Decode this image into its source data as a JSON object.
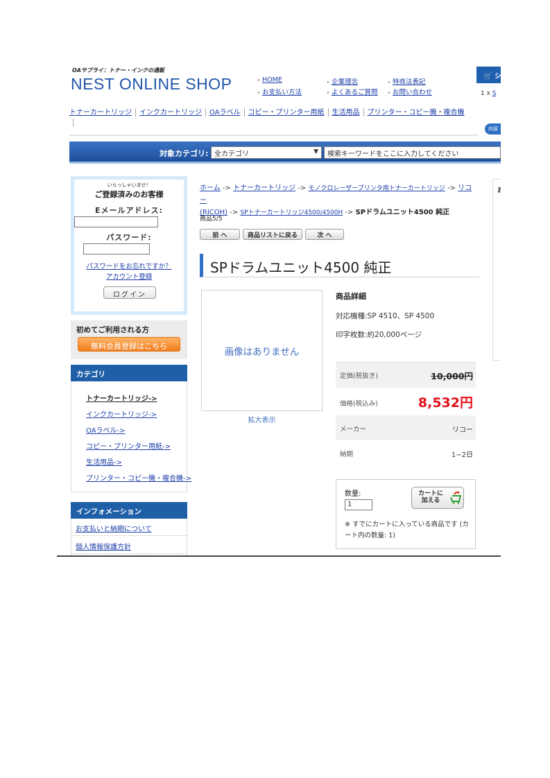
{
  "header": {
    "tagline": "OAサプライ：トナー・インクの通販",
    "logo": "NEST ONLINE SHOP",
    "links": [
      "HOME",
      "企業理念",
      "特商法表記",
      "お支払い方法",
      "よくあるご質問",
      "お問い合わせ"
    ],
    "cart": {
      "title": "シ",
      "line_qty": "1 x",
      "line_link": "S",
      "button": "内容"
    }
  },
  "category_nav": [
    "トナーカートリッジ",
    "インクカートリッジ",
    "OAラベル",
    "コピー・プリンター用紙",
    "生活用品",
    "プリンター・コピー機・複合機"
  ],
  "search": {
    "label": "対象カテゴリ:",
    "category_value": "全カテゴリ",
    "placeholder": "検索キーワードをここに入力してください"
  },
  "login": {
    "greeting_small": "いらっしゃいませ！",
    "greeting": "ご登録済みのお客様",
    "email_label": "Eメールアドレス:",
    "email_value": "",
    "password_label": "パスワード:",
    "password_value": "",
    "forgot": "パスワードをお忘れですか？",
    "register": "アカウント登録",
    "login_button": "ログイン"
  },
  "first_time": {
    "title": "初めてご利用される方",
    "button": "無料会員登録はこちら"
  },
  "categories": {
    "title": "カテゴリ",
    "items": [
      "トナーカートリッジ->",
      "インクカートリッジ->",
      "OAラベル->",
      "コピー・プリンター用紙->",
      "生活用品->",
      "プリンター・コピー機・複合機->"
    ]
  },
  "information": {
    "title": "インフォメーション",
    "items": [
      "お支払いと納期について",
      "個人情報保護方針"
    ]
  },
  "breadcrumb": {
    "links": [
      "ホーム",
      "トナーカートリッジ",
      "モノクロレーザープリンタ用トナーカートリッジ",
      "リコー",
      "(RICOH)",
      "SPトナーカートリッジ4500/4500H"
    ],
    "sep": "->",
    "current": "SPドラムユニット4500 純正"
  },
  "product": {
    "count": "商品5/5",
    "prev": "前 へ",
    "list": "商品リストに戻る",
    "next": "次 へ",
    "title": "SPドラムユニット4500 純正",
    "no_image": "画像はありません",
    "zoom": "拡大表示",
    "detail_title": "商品詳細",
    "compat": "対応機種:SP 4510、SP 4500",
    "yield": "印字枚数:約20,000ページ",
    "list_price_label": "定価(税抜き)",
    "list_price": "10,000円",
    "price_label": "価格(税込み)",
    "price": "8,532円",
    "maker_label": "メーカー",
    "maker": "リコー",
    "delivery_label": "納期",
    "delivery": "1−2日"
  },
  "order": {
    "qty_label": "数量:",
    "qty_value": "1",
    "add_to_cart": "カートに加える",
    "note": "※ すでにカートに入っている商品です (カート内の数量: 1)"
  },
  "right_panel": {
    "label": "お"
  },
  "colors": {
    "brand_blue": "#1f55a8",
    "link": "#1a3da8",
    "price_red": "#e0101a",
    "signup_orange": "#f07d1e"
  }
}
